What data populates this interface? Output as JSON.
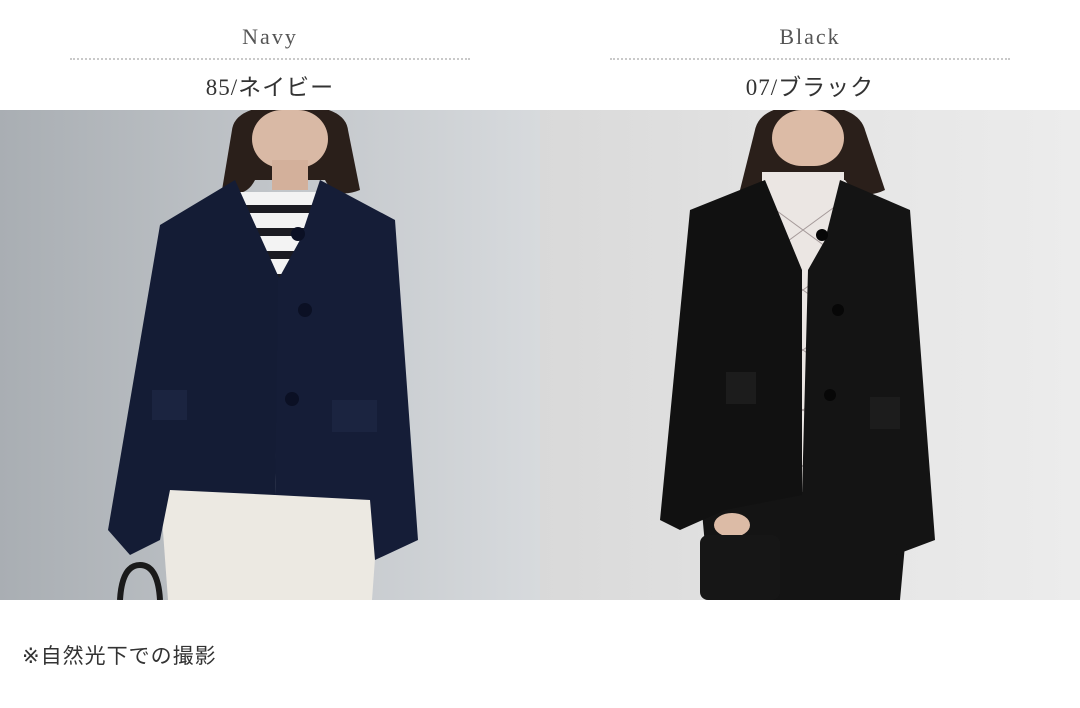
{
  "variants": [
    {
      "name_en": "Navy",
      "code": "85/ネイビー",
      "jacket_color": "#141c35",
      "photo_alt": "navy jacket photo"
    },
    {
      "name_en": "Black",
      "code": "07/ブラック",
      "jacket_color": "#111111",
      "photo_alt": "black jacket photo"
    }
  ],
  "note": "※自然光下での撮影"
}
